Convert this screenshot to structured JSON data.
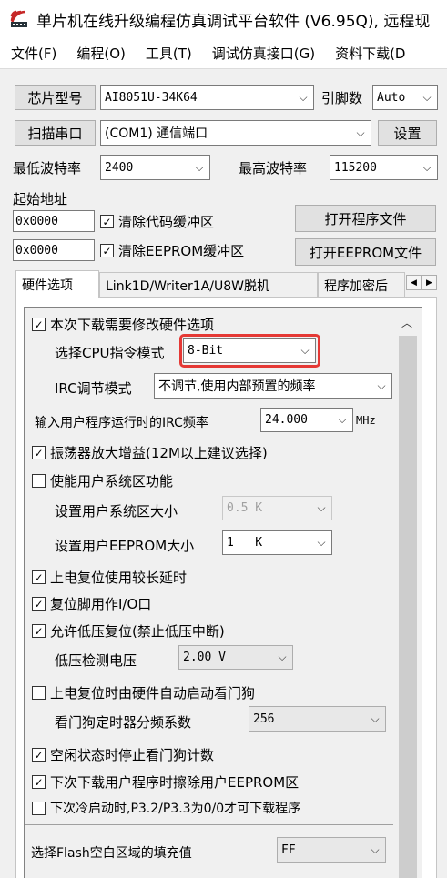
{
  "window": {
    "title": "单片机在线升级编程仿真调试平台软件 (V6.95Q), 远程现"
  },
  "menu": [
    "文件(F)",
    "编程(O)",
    "工具(T)",
    "调试仿真接口(G)",
    "资料下载(D"
  ],
  "chip": {
    "button": "芯片型号",
    "value": "AI8051U-34K64",
    "pins_label": "引脚数",
    "pins_value": "Auto"
  },
  "port": {
    "button": "扫描串口",
    "value": "(COM1) 通信端口",
    "settings": "设置"
  },
  "baud": {
    "min_label": "最低波特率",
    "min_value": "2400",
    "max_label": "最高波特率",
    "max_value": "115200"
  },
  "start": {
    "label": "起始地址"
  },
  "code_row": {
    "address": "0x0000",
    "clear_label": "清除代码缓冲区",
    "clear_checked": true,
    "open_button": "打开程序文件"
  },
  "eeprom_row": {
    "address": "0x0000",
    "clear_label": "清除EEPROM缓冲区",
    "clear_checked": true,
    "open_button": "打开EEPROM文件"
  },
  "tabs": [
    "硬件选项",
    "Link1D/Writer1A/U8W脱机",
    "程序加密后"
  ],
  "hw": {
    "modify": {
      "label": "本次下载需要修改硬件选项",
      "checked": true
    },
    "cpu_mode": {
      "label": "选择CPU指令模式",
      "value": "8-Bit"
    },
    "irc_mode": {
      "label": "IRC调节模式",
      "value": "不调节,使用内部预置的频率"
    },
    "irc_freq": {
      "label": "输入用户程序运行时的IRC频率",
      "value": "24.000",
      "unit": "MHz"
    },
    "osc_gain": {
      "label": "振荡器放大增益(12M以上建议选择)",
      "checked": true
    },
    "sys_area": {
      "label": "使能用户系统区功能",
      "checked": false
    },
    "sys_size": {
      "label": "设置用户系统区大小",
      "value": "0.5 K"
    },
    "eeprom_size": {
      "label": "设置用户EEPROM大小",
      "value": "1   K"
    },
    "power_delay": {
      "label": "上电复位使用较长延时",
      "checked": true
    },
    "reset_io": {
      "label": "复位脚用作I/O口",
      "checked": true
    },
    "lvr": {
      "label": "允许低压复位(禁止低压中断)",
      "checked": true
    },
    "lvd": {
      "label": "低压检测电压",
      "value": "2.00 V"
    },
    "wdt_auto": {
      "label": "上电复位时由硬件自动启动看门狗",
      "checked": false
    },
    "wdt_div": {
      "label": "看门狗定时器分频系数",
      "value": "256"
    },
    "wdt_idle": {
      "label": "空闲状态时停止看门狗计数",
      "checked": true
    },
    "erase_eeprom": {
      "label": "下次下载用户程序时擦除用户EEPROM区",
      "checked": true
    },
    "cold_boot": {
      "label": "下次冷启动时,P3.2/P3.3为0/0才可下载程序",
      "checked": false
    },
    "flash_fill": {
      "label": "选择Flash空白区域的填充值",
      "value": "FF"
    }
  },
  "colors": {
    "highlight": "#e53935",
    "title_icon": "#c62828"
  }
}
